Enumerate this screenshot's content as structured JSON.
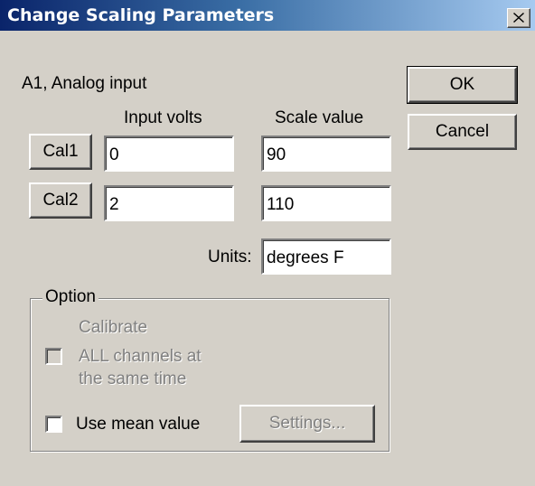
{
  "window": {
    "title": "Change Scaling Parameters",
    "close_glyph": "✕"
  },
  "channel": {
    "label": "A1, Analog input"
  },
  "columns": {
    "input_volts": "Input volts",
    "scale_value": "Scale value"
  },
  "cal1": {
    "button_label": "Cal1",
    "input_volts": "0",
    "scale_value": "90"
  },
  "cal2": {
    "button_label": "Cal2",
    "input_volts": "2",
    "scale_value": "110"
  },
  "units": {
    "label": "Units:",
    "value": "degrees F"
  },
  "buttons": {
    "ok": "OK",
    "cancel": "Cancel"
  },
  "option": {
    "legend": "Option",
    "calibrate_all_line1": "Calibrate",
    "calibrate_all_line2": "ALL channels at",
    "calibrate_all_line3": "the same time",
    "use_mean_label": "Use mean value",
    "settings_label": "Settings..."
  },
  "colors": {
    "face": "#d4d0c8",
    "title_start": "#0a246a",
    "title_end": "#a6caf0"
  }
}
